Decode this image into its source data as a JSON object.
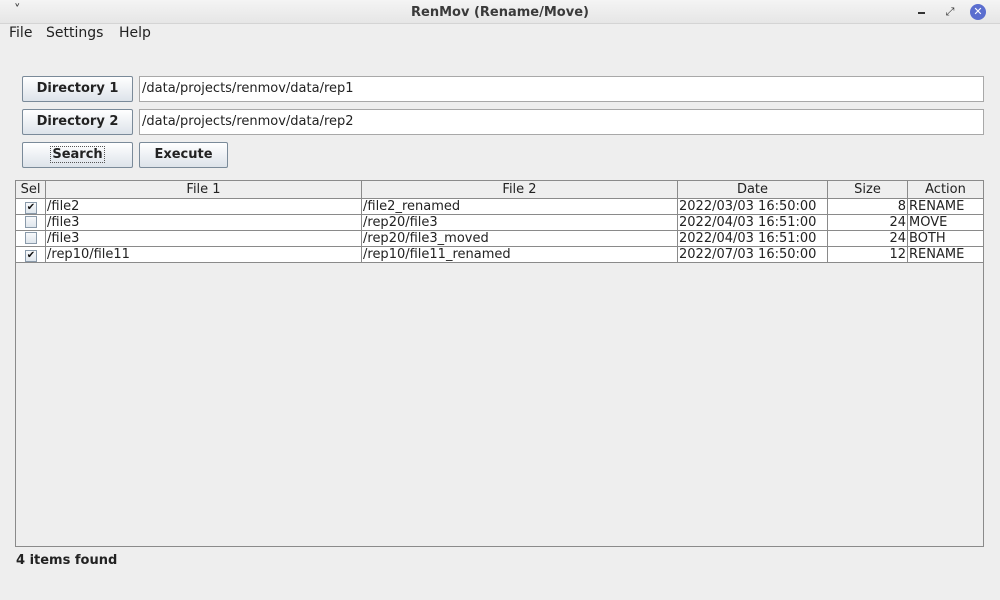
{
  "window": {
    "title": "RenMov (Rename/Move)",
    "menu_icon": "˅",
    "max_icon": "⤢",
    "close_icon": "✕"
  },
  "menu": [
    "File",
    "Settings",
    "Help"
  ],
  "directories": {
    "dir1_label": "Directory 1",
    "dir1_value": "/data/projects/renmov/data/rep1",
    "dir2_label": "Directory 2",
    "dir2_value": "/data/projects/renmov/data/rep2"
  },
  "actions": {
    "search_label": "Search",
    "execute_label": "Execute"
  },
  "table": {
    "columns": [
      "Sel",
      "File 1",
      "File 2",
      "Date",
      "Size",
      "Action"
    ],
    "rows": [
      {
        "sel": true,
        "file1": "/file2",
        "file2": "/file2_renamed",
        "date": "2022/03/03 16:50:00",
        "size": "8",
        "action": "RENAME"
      },
      {
        "sel": false,
        "file1": "/file3",
        "file2": "/rep20/file3",
        "date": "2022/04/03 16:51:00",
        "size": "24",
        "action": "MOVE"
      },
      {
        "sel": false,
        "file1": "/file3",
        "file2": "/rep20/file3_moved",
        "date": "2022/04/03 16:51:00",
        "size": "24",
        "action": "BOTH"
      },
      {
        "sel": true,
        "file1": "/rep10/file11",
        "file2": "/rep10/file11_renamed",
        "date": "2022/07/03 16:50:00",
        "size": "12",
        "action": "RENAME"
      }
    ]
  },
  "status": "4 items found",
  "check_glyph": "✔"
}
